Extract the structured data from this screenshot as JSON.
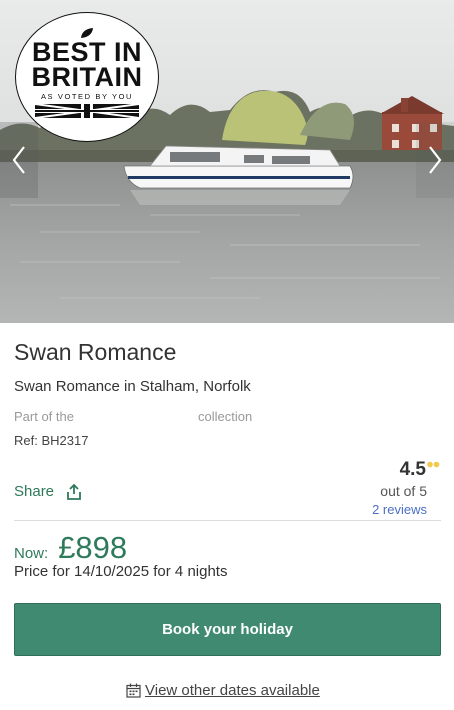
{
  "hero": {
    "badge": {
      "line1": "BEST IN",
      "line2": "BRITAIN",
      "sub": "AS VOTED BY YOU"
    },
    "icons": {
      "prev": "chevron-left-icon",
      "next": "chevron-right-icon"
    }
  },
  "listing": {
    "title": "Swan Romance",
    "subtitle": "Swan Romance in Stalham, Norfolk",
    "part_of": "Part of the",
    "collection": "collection",
    "ref": "Ref: BH2317"
  },
  "share": {
    "label": "Share",
    "icon": "share-upload-icon"
  },
  "rating": {
    "value": "4.5",
    "out_of": "out of 5",
    "reviews": "2 reviews"
  },
  "pricing": {
    "now_label": "Now:",
    "price": "£898",
    "description": "Price for 14/10/2025 for 4 nights"
  },
  "actions": {
    "book_label": "Book your holiday",
    "dates_label": "View other dates available",
    "dates_icon": "calendar-icon"
  },
  "colors": {
    "accent_green": "#3f8a70",
    "text_green": "#2e7a5a",
    "link_blue": "#4a6fc5",
    "rating_dots": "#f2c94c"
  }
}
